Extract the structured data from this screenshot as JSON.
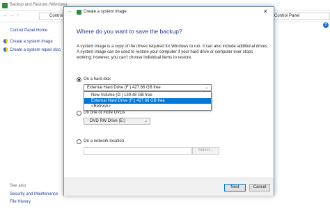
{
  "background_window": {
    "title": "Backup and Restore (Windows",
    "address_crumb": "Control",
    "control_panel_crumb": "Control Panel",
    "help_glyph": "?",
    "sidebar": {
      "home": "Control Panel Home",
      "create_image": "Create a system image",
      "create_disc": "Create a system repair disc"
    },
    "see_also": {
      "label": "See also",
      "security": "Security and Maintenance",
      "file_history": "File History"
    }
  },
  "dialog": {
    "title": "Create a system image",
    "heading": "Where do you want to save the backup?",
    "description": "A system image is a copy of the drives required for Windows to run. It can also include additional drives. A system image can be used to restore your computer if your hard drive or computer ever stops working; however, you can't choose individual items to restore.",
    "options": {
      "hard_disk": {
        "label": "On a hard disk",
        "checked": true,
        "selected_value": "External Hard Drive (F:)  427.66 GB free",
        "dropdown_items": [
          "New Volume (D:)  139.48 GB free",
          "External Hard Drive (F:)  427.66 GB free",
          "<Refresh>"
        ],
        "selected_index": 1
      },
      "dvds": {
        "label": "On one or more DVDs",
        "checked": false,
        "selected_value": "DVD RW Drive (E:)"
      },
      "network": {
        "label": "On a network location",
        "checked": false,
        "input_value": "",
        "select_button": "Select..."
      }
    },
    "buttons": {
      "next": "Next",
      "cancel": "Cancel"
    }
  },
  "colors": {
    "accent": "#0078d7",
    "heading": "#1e3796",
    "link": "#1e3c96"
  }
}
